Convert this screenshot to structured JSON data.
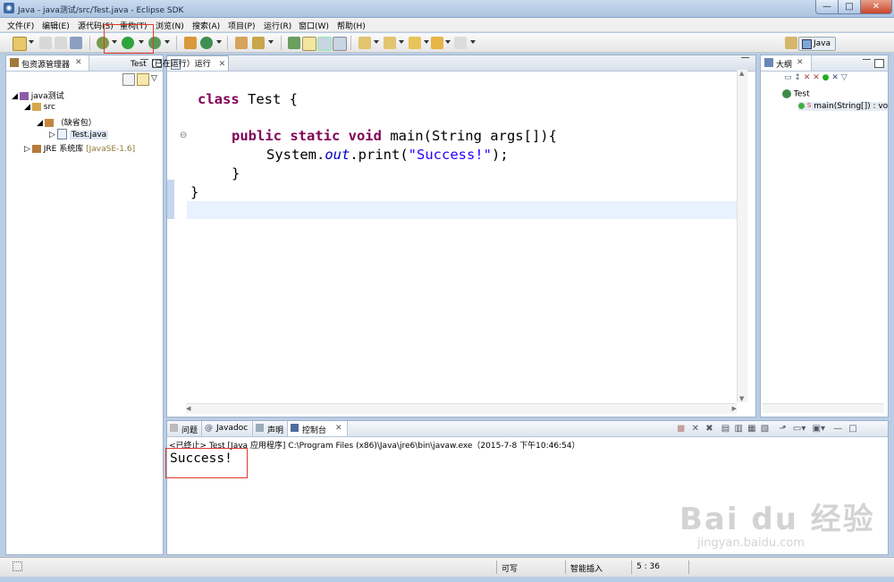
{
  "window": {
    "title": "Java  - java测试/src/Test.java  - Eclipse SDK",
    "min": "—",
    "max": "□",
    "close": "✕"
  },
  "menu": [
    "文件(F)",
    "编辑(E)",
    "源代码(S)",
    "重构(T)",
    "浏览(N)",
    "搜索(A)",
    "项目(P)",
    "运行(R)",
    "窗口(W)",
    "帮助(H)"
  ],
  "perspective": {
    "label": "Java"
  },
  "package_explorer": {
    "tab": "包资源管理器",
    "tree": [
      {
        "label": "java测试",
        "icon": "project-icon"
      },
      {
        "label": "src",
        "icon": "source-folder-icon"
      },
      {
        "label": "（缺省包）",
        "icon": "package-icon"
      },
      {
        "label": "Test.java",
        "icon": "java-file-icon"
      },
      {
        "label": "JRE 系统库",
        "suffix": "[JavaSE-1.6]",
        "icon": "library-icon"
      }
    ]
  },
  "editor": {
    "tab": "Test（已在运行）运行",
    "lines": {
      "l1a": "class",
      "l1b": " Test {",
      "l3a": "public static void",
      "l3b": " main(String args[]){",
      "l4a": "System.",
      "l4b": "out",
      "l4c": ".print(",
      "l4d": "\"Success!\"",
      "l4e": ");",
      "l5": "}",
      "l6": "}"
    }
  },
  "outline": {
    "tab": "大纲",
    "class": "Test",
    "method": "main(String[]) : vo"
  },
  "bottom": {
    "tabs": [
      "问题",
      "Javadoc",
      "声明",
      "控制台"
    ],
    "console_header": "<已终止> Test [Java 应用程序] C:\\Program Files (x86)\\Java\\jre6\\bin\\javaw.exe（2015-7-8 下午10:46:54）",
    "output": "Success!"
  },
  "status": {
    "writable": "可写",
    "insert": "智能插入",
    "position": "5 : 36"
  },
  "watermark": {
    "brand": "Bai du 经验",
    "url": "jingyan.baidu.com"
  },
  "colors": {
    "keyword": "#7f0055",
    "string": "#2a00ff",
    "field": "#0000c0",
    "highlight_box": "#e23a2a"
  }
}
